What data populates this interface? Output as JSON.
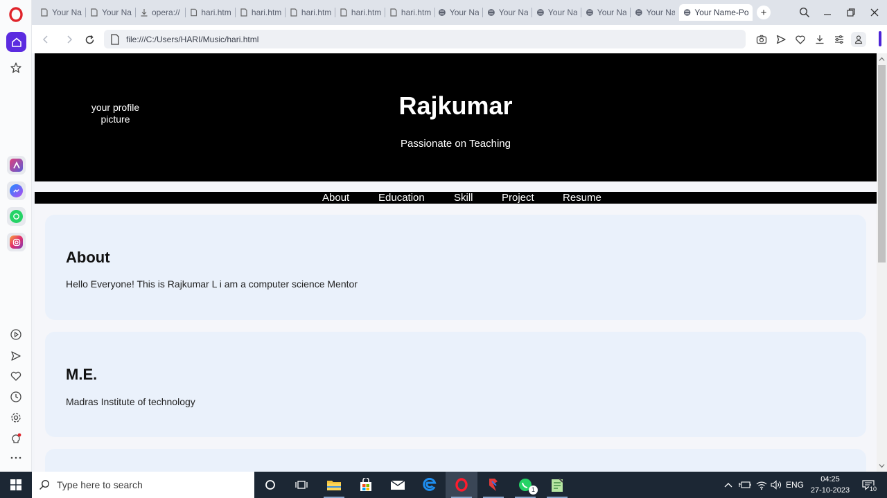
{
  "tabs": [
    {
      "label": "Your Na",
      "icon": "page-icon"
    },
    {
      "label": "Your Na",
      "icon": "page-icon"
    },
    {
      "label": "opera://",
      "icon": "download-icon"
    },
    {
      "label": "hari.html",
      "icon": "page-icon"
    },
    {
      "label": "hari.htm",
      "icon": "page-icon"
    },
    {
      "label": "hari.htm",
      "icon": "page-icon"
    },
    {
      "label": "hari.htm",
      "icon": "page-icon"
    },
    {
      "label": "hari.htm",
      "icon": "page-icon"
    },
    {
      "label": "Your Na",
      "icon": "globe-icon"
    },
    {
      "label": "Your Na",
      "icon": "globe-icon"
    },
    {
      "label": "Your Na",
      "icon": "globe-icon"
    },
    {
      "label": "Your Na",
      "icon": "globe-icon"
    },
    {
      "label": "Your Na",
      "icon": "globe-icon"
    },
    {
      "label": "Your Name-Por",
      "icon": "globe-icon",
      "active": true
    }
  ],
  "address": {
    "url": "file:///C:/Users/HARI/Music/hari.html"
  },
  "page": {
    "profile_picture_text": "your profile picture",
    "name": "Rajkumar",
    "tagline": "Passionate on Teaching",
    "nav": [
      "About",
      "Education",
      "Skill",
      "Project",
      "Resume"
    ],
    "about": {
      "heading": "About",
      "text": "Hello Everyone! This is Rajkumar L i am a computer science Mentor"
    },
    "education": {
      "heading": "M.E.",
      "text": "Madras Institute of technology"
    }
  },
  "taskbar": {
    "search_placeholder": "Type here to search",
    "language": "ENG",
    "time": "04:25",
    "date": "27-10-2023",
    "notification_count": "10",
    "whatsapp_badge": "1"
  },
  "colors": {
    "opera_accent": "#5b2be0",
    "hero_bg": "#000000",
    "card_bg": "#eaf1fb",
    "taskbar_bg": "#1c2734"
  }
}
